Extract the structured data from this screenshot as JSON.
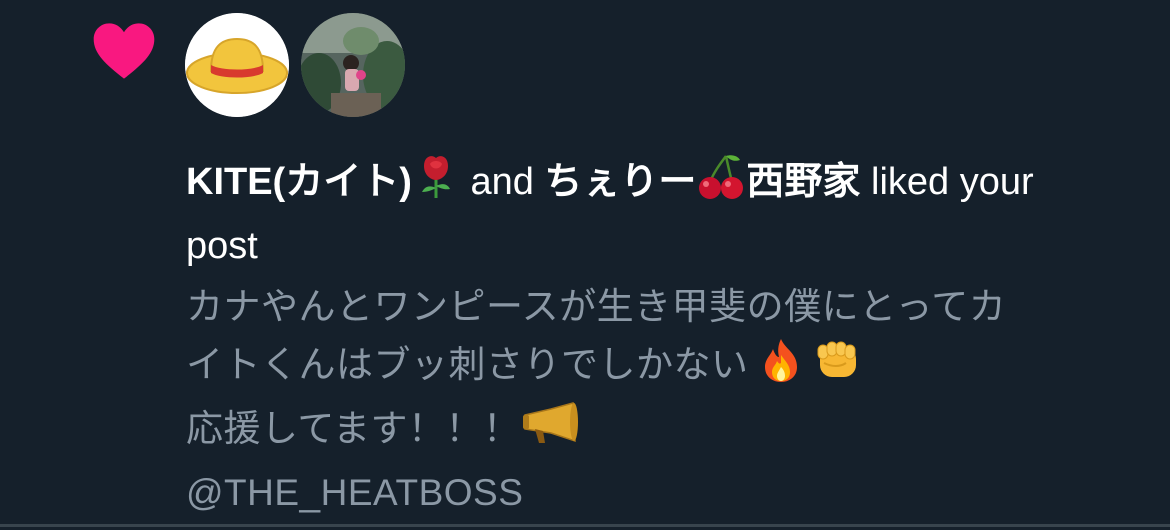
{
  "notification": {
    "user1": {
      "name": "KITE(カイト)",
      "emoji": "rose-emoji"
    },
    "conjunction": "and",
    "user2": {
      "name": "ちぇりー",
      "emoji": "cherries-emoji",
      "suffix": "西野家"
    },
    "action": "liked",
    "action_rest": "your post",
    "post": {
      "line1": "カナやんとワンピースが生き甲斐の僕にとってカ",
      "line2": "イトくんはブッ刺さりでしかない",
      "line2_emojis": [
        "fire-emoji",
        "fist-emoji"
      ],
      "line3": "応援してます！！！",
      "line3_emoji": "megaphone-emoji",
      "mention": "@THE_HEATBOSS"
    }
  },
  "colors": {
    "background": "#15202b",
    "heart": "#f91880",
    "primary_text": "#ffffff",
    "secondary_text": "#8b98a5",
    "divider": "#38444d"
  }
}
